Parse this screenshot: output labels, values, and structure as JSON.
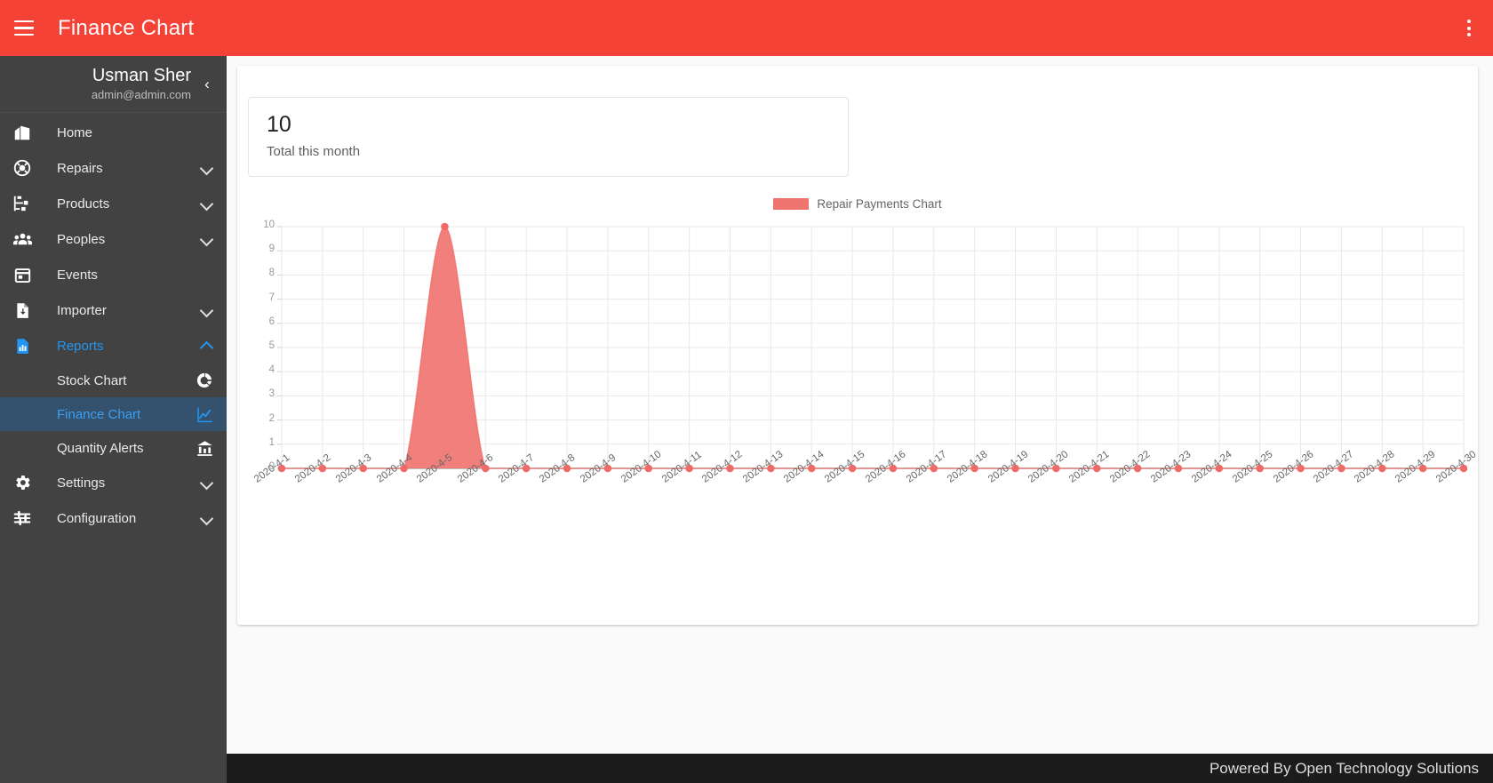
{
  "topbar": {
    "title": "Finance Chart",
    "menu_icon": "hamburger-icon",
    "overflow_icon": "kebab-menu-icon"
  },
  "sidebar": {
    "user": {
      "name": "Usman Sher",
      "email": "admin@admin.com"
    },
    "collapse_glyph": "‹",
    "items": [
      {
        "label": "Home",
        "icon": "home-icon",
        "expandable": false
      },
      {
        "label": "Repairs",
        "icon": "lifebuoy-icon",
        "expandable": true
      },
      {
        "label": "Products",
        "icon": "hierarchy-icon",
        "expandable": true
      },
      {
        "label": "Peoples",
        "icon": "people-icon",
        "expandable": true
      },
      {
        "label": "Events",
        "icon": "calendar-icon",
        "expandable": false
      },
      {
        "label": "Importer",
        "icon": "file-import-icon",
        "expandable": true
      },
      {
        "label": "Reports",
        "icon": "report-chart-icon",
        "expandable": true,
        "expanded": true,
        "active": true
      }
    ],
    "reports_sub": [
      {
        "label": "Stock Chart",
        "icon": "donut-chart-icon",
        "selected": false
      },
      {
        "label": "Finance Chart",
        "icon": "line-chart-icon",
        "selected": true
      },
      {
        "label": "Quantity Alerts",
        "icon": "bank-chart-icon",
        "selected": false
      }
    ],
    "items_bottom": [
      {
        "label": "Settings",
        "icon": "gear-icon",
        "expandable": true
      },
      {
        "label": "Configuration",
        "icon": "sliders-icon",
        "expandable": true
      }
    ]
  },
  "main": {
    "stat": {
      "value": "10",
      "label": "Total this month"
    }
  },
  "footer": {
    "text": "Powered By Open Technology Solutions"
  },
  "colors": {
    "brand_red": "#f44336",
    "sidebar_bg": "#424242",
    "accent_blue": "#2196f3",
    "selected_bg": "#34516d",
    "series_fill": "#f07470",
    "series_point": "#ef6b68"
  },
  "chart_data": {
    "type": "area",
    "title": "",
    "legend": [
      {
        "name": "Repair Payments Chart",
        "color": "#f07470"
      }
    ],
    "legend_position": "top-center",
    "xlabel": "",
    "ylabel": "",
    "ylim": [
      0,
      10
    ],
    "yticks": [
      0,
      1,
      2,
      3,
      4,
      5,
      6,
      7,
      8,
      9,
      10
    ],
    "grid": true,
    "smooth": true,
    "categories": [
      "2020-4-1",
      "2020-4-2",
      "2020-4-3",
      "2020-4-4",
      "2020-4-5",
      "2020-4-6",
      "2020-4-7",
      "2020-4-8",
      "2020-4-9",
      "2020-4-10",
      "2020-4-11",
      "2020-4-12",
      "2020-4-13",
      "2020-4-14",
      "2020-4-15",
      "2020-4-16",
      "2020-4-17",
      "2020-4-18",
      "2020-4-19",
      "2020-4-20",
      "2020-4-21",
      "2020-4-22",
      "2020-4-23",
      "2020-4-24",
      "2020-4-25",
      "2020-4-26",
      "2020-4-27",
      "2020-4-28",
      "2020-4-29",
      "2020-4-30"
    ],
    "series": [
      {
        "name": "Repair Payments Chart",
        "values": [
          0,
          0,
          0,
          0,
          10,
          0,
          0,
          0,
          0,
          0,
          0,
          0,
          0,
          0,
          0,
          0,
          0,
          0,
          0,
          0,
          0,
          0,
          0,
          0,
          0,
          0,
          0,
          0,
          0,
          0
        ]
      }
    ]
  }
}
